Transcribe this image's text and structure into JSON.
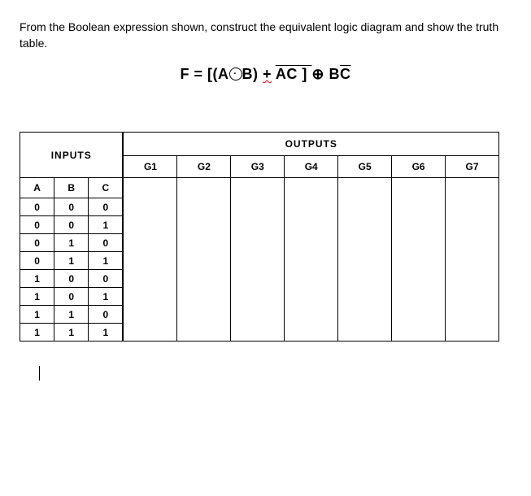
{
  "instruction": "From the Boolean expression shown, construct the equivalent logic diagram and show the truth table.",
  "expression": {
    "prefix": "F = [(A",
    "xor_sym": "⊙",
    "after_xor": "B) ",
    "plus": "+",
    "ac_bar": "A",
    "c_after": "C ] ",
    "oplus": "⊕",
    "bc_prefix": " B",
    "c_bar": "C"
  },
  "headers": {
    "inputs": "INPUTS",
    "outputs": "OUTPUTS",
    "A": "A",
    "B": "B",
    "C": "C",
    "G1": "G1",
    "G2": "G2",
    "G3": "G3",
    "G4": "G4",
    "G5": "G5",
    "G6": "G6",
    "G7": "G7"
  },
  "rows": [
    {
      "A": "0",
      "B": "0",
      "C": "0"
    },
    {
      "A": "0",
      "B": "0",
      "C": "1"
    },
    {
      "A": "0",
      "B": "1",
      "C": "0"
    },
    {
      "A": "0",
      "B": "1",
      "C": "1"
    },
    {
      "A": "1",
      "B": "0",
      "C": "0"
    },
    {
      "A": "1",
      "B": "0",
      "C": "1"
    },
    {
      "A": "1",
      "B": "1",
      "C": "0"
    },
    {
      "A": "1",
      "B": "1",
      "C": "1"
    }
  ]
}
